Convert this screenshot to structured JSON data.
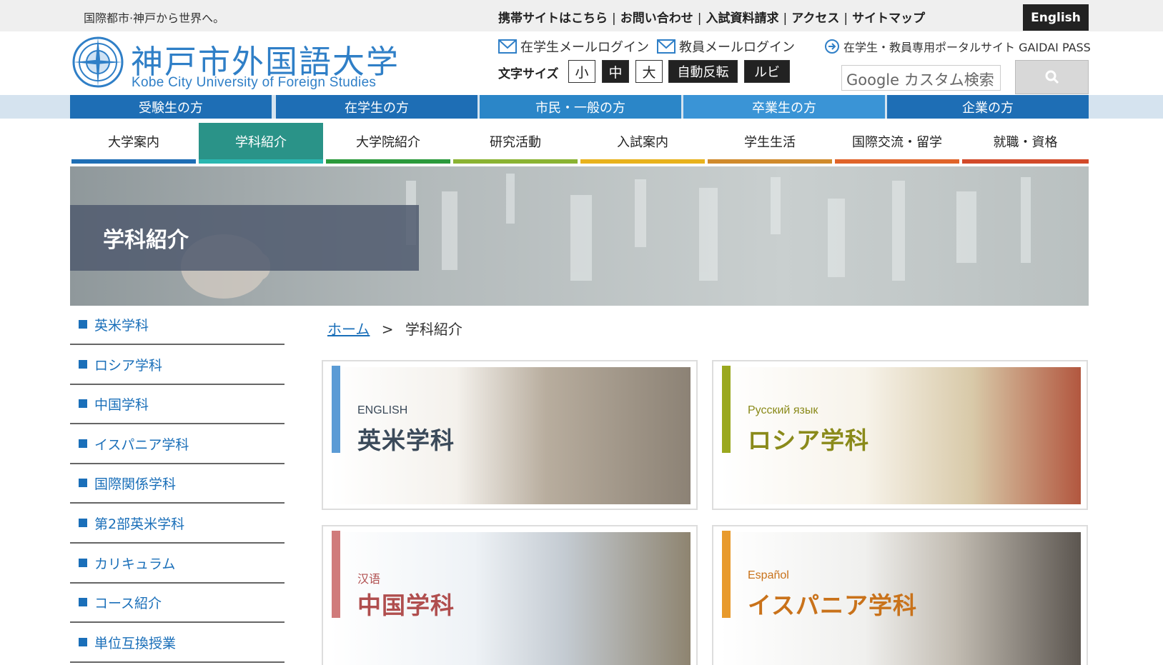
{
  "header": {
    "tagline": "国際都市·神戸から世界へ。",
    "util_links": [
      "携帯サイトはこちら",
      "お問い合わせ",
      "入試資料請求",
      "アクセス",
      "サイトマップ"
    ],
    "english_label": "English",
    "logo_title": "神戸市外国語大学",
    "logo_subtitle": "Kobe City University of Foreign Studies",
    "mail_students": "在学生メールログイン",
    "mail_staff": "教員メールログイン",
    "portal": "在学生・教員専用ポータルサイト GAIDAI PASS",
    "font_size_label": "文字サイズ",
    "font_small": "小",
    "font_mid": "中",
    "font_large": "大",
    "invert_label": "自動反転",
    "ruby_label": "ルビ",
    "search_placeholder": "Google カスタム検索"
  },
  "audience_nav": [
    {
      "label": "受験生の方",
      "color": "#1e6eb5"
    },
    {
      "label": "在学生の方",
      "color": "#1e6eb5"
    },
    {
      "label": "市民・一般の方",
      "color": "#2b86c8"
    },
    {
      "label": "卒業生の方",
      "color": "#3a94d6"
    },
    {
      "label": "企業の方",
      "color": "#1e6eb5"
    }
  ],
  "main_nav": [
    {
      "label": "大学案内",
      "color": "#1e6eb5"
    },
    {
      "label": "学科紹介",
      "color": "#2ab7b0",
      "active": true
    },
    {
      "label": "大学院紹介",
      "color": "#2b9a3c"
    },
    {
      "label": "研究活動",
      "color": "#8ab332"
    },
    {
      "label": "入試案内",
      "color": "#e8b21c"
    },
    {
      "label": "学生生活",
      "color": "#d08a2c"
    },
    {
      "label": "国際交流・留学",
      "color": "#e0642a"
    },
    {
      "label": "就職・資格",
      "color": "#d24a2a"
    }
  ],
  "hero": {
    "title": "学科紹介"
  },
  "sidebar": [
    "英米学科",
    "ロシア学科",
    "中国学科",
    "イスパニア学科",
    "国際関係学科",
    "第2部英米学科",
    "カリキュラム",
    "コース紹介",
    "単位互換授業"
  ],
  "breadcrumb": {
    "home": "ホーム",
    "sep": ">",
    "current": "学科紹介"
  },
  "cards": [
    {
      "sub": "ENGLISH",
      "name": "英米学科",
      "accent": "#5b9bd5",
      "text_color": "#3b4a5a"
    },
    {
      "sub": "Русский язык",
      "name": "ロシア学科",
      "accent": "#9aa81f",
      "text_color": "#8a8a1a"
    },
    {
      "sub": "汉语",
      "name": "中国学科",
      "accent": "#d07b7b",
      "text_color": "#b04e4e"
    },
    {
      "sub": "Español",
      "name": "イスパニア学科",
      "accent": "#e89a2c",
      "text_color": "#c9721a"
    }
  ]
}
